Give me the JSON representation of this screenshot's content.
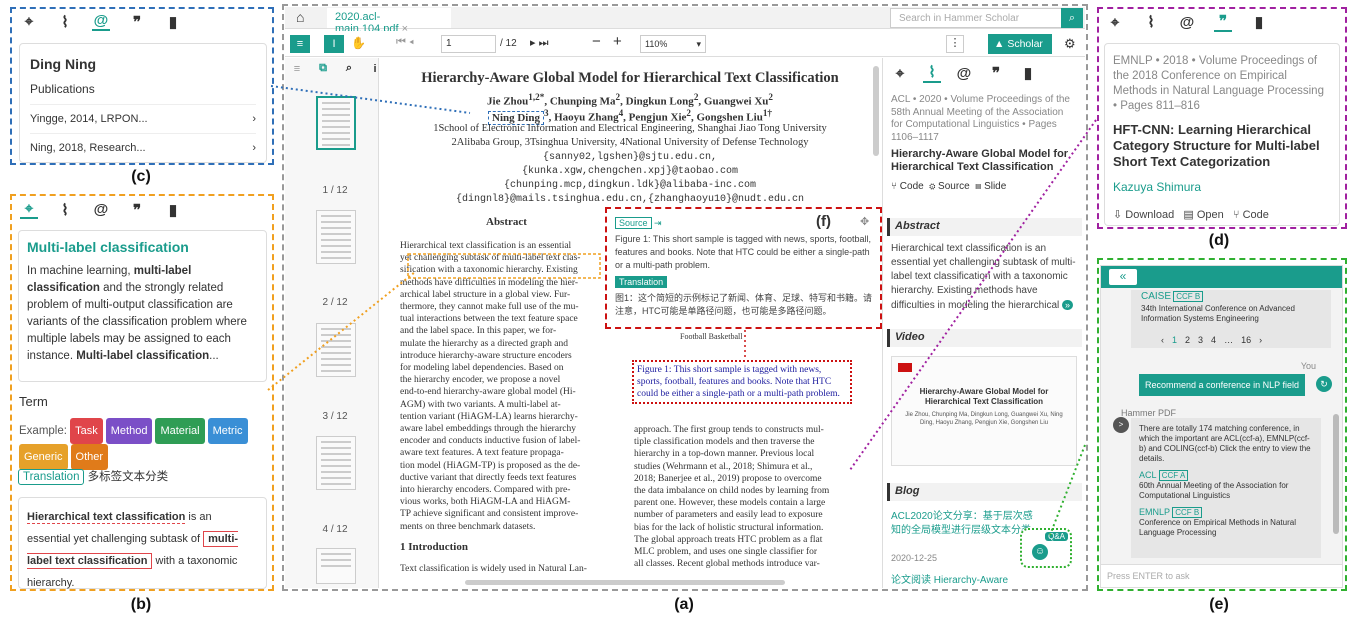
{
  "panel_labels": {
    "a": "(a)",
    "b": "(b)",
    "c": "(c)",
    "d": "(d)",
    "e": "(e)",
    "f": "(f)"
  },
  "panel_c": {
    "name": "Ding Ning",
    "section": "Publications",
    "items": [
      "Yingge, 2014, LRPON...",
      "Ning, 2018, Research..."
    ]
  },
  "panel_b": {
    "title": "Multi-label classification",
    "desc_parts": [
      "In machine learning, ",
      "multi-label classification",
      " and the strongly related problem of multi-output classification are variants of the classification problem where multiple labels may be assigned to each instance. ",
      "Multi-label classification",
      "..."
    ],
    "term_title": "Term",
    "example_label": "Example:",
    "tags": [
      {
        "t": "Task",
        "c": "#e0454a"
      },
      {
        "t": "Method",
        "c": "#7b4fc7"
      },
      {
        "t": "Material",
        "c": "#2f9d55"
      },
      {
        "t": "Metric",
        "c": "#3a8fd6"
      },
      {
        "t": "Generic",
        "c": "#e6a12a"
      },
      {
        "t": "Other",
        "c": "#e07b1a"
      }
    ],
    "translation_label": "Translation",
    "translation_text": "多标签文本分类",
    "snippet": {
      "a": "Hierarchical text classification",
      "b": " is an essential yet challenging subtask of ",
      "c": "multi-label text classification",
      "d": " with a taxonomic hierarchy."
    }
  },
  "viewer": {
    "tab": "2020.acl-main.104.pdf",
    "search_placeholder": "Search in Hammer Scholar",
    "page": "1",
    "page_total": "/ 12",
    "zoom": "110%",
    "scholar": "Scholar",
    "thumbs": [
      "1 / 12",
      "2 / 12",
      "3 / 12",
      "4 / 12"
    ],
    "paper": {
      "title": "Hierarchy-Aware Global Model for Hierarchical Text Classification",
      "authors1": "Jie Zhou",
      "authors1b": "1,2*",
      "authors1c": ", Chunping Ma",
      "authors1d": "2",
      "authors1e": ", Dingkun Long",
      "authors1f": "2",
      "authors1g": ", Guangwei Xu",
      "authors1h": "2",
      "authors2a": "Ning Ding",
      "authors2b": "3",
      "authors2c": ", Haoyu Zhang",
      "authors2d": "4",
      "authors2e": ", Pengjun Xie",
      "authors2f": "2",
      "authors2g": ", Gongshen Liu",
      "authors2h": "1†",
      "aff1": "1School of Electronic Information and Electrical Engineering, Shanghai Jiao Tong University",
      "aff2": "2Alibaba Group, 3Tsinghua University, 4National University of Defense Technology",
      "emails": [
        "{sanny02,lgshen}@sjtu.edu.cn,",
        "{kunka.xgw,chengchen.xpj}@taobao.com",
        "{chunping.mcp,dingkun.ldk}@alibaba-inc.com",
        "{dingnl8}@mails.tsinghua.edu.cn,{zhanghaoyu10}@nudt.edu.cn"
      ],
      "abstract_h": "Abstract",
      "abstract_lines": [
        "Hierarchical text classification is an essential",
        "yet challenging subtask of multi-label text clas-",
        "sification with a taxonomic hierarchy. Existing",
        "methods have difficulties in modeling the hier-",
        "archical label structure in a global view. Fur-",
        "thermore, they cannot make full use of the mu-",
        "tual interactions between the text feature space",
        "and the label space. In this paper, we for-",
        "mulate the hierarchy as a directed graph and",
        "introduce hierarchy-aware structure encoders",
        "for modeling label dependencies. Based on",
        "the hierarchy encoder, we propose a novel",
        "end-to-end hierarchy-aware global model (Hi-",
        "AGM) with two variants. A multi-label at-",
        "tention variant (HiAGM-LA) learns hierarchy-",
        "aware label embeddings through the hierarchy",
        "encoder and conducts inductive fusion of label-",
        "aware text features. A text feature propaga-",
        "tion model (HiAGM-TP) is proposed as the de-",
        "ductive variant that directly feeds text features",
        "into hierarchy encoders. Compared with pre-",
        "vious works, both HiAGM-LA and HiAGM-",
        "TP achieve significant and consistent improve-",
        "ments on three benchmark datasets."
      ],
      "intro_h": "1   Introduction",
      "intro_line": "Text classification is widely used in Natural Lan-",
      "fig_labels": "Football  Basketball",
      "fig_caption": "Figure 1: This short sample is tagged with news, sports, football, features and books. Note that HTC could be either a single-path or a multi-path problem.",
      "right_lines": [
        "approach. The first group tends to constructs mul-",
        "tiple classification models and then traverse the",
        "hierarchy in a top-down manner. Previous local",
        "studies (Wehrmann et al., 2018; Shimura et al.,",
        "2018; Banerjee et al., 2019) propose to overcome",
        "the data imbalance on child nodes by learning from",
        "parent one. However, these models contain a large",
        "number of parameters and easily lead to exposure",
        "bias for the lack of holistic structural information.",
        "The global approach treats HTC problem as a flat",
        "MLC problem, and uses one single classifier for",
        "all classes. Recent global methods introduce var-"
      ]
    },
    "popup": {
      "source": "Source",
      "text": "Figure 1: This short sample is tagged with news, sports, football, features and books. Note that HTC could be either a single-path or a multi-path problem.",
      "translation": "Translation",
      "trans_text": "图1：这个简短的示例标记了新闻、体育、足球、特写和书籍。请注意，HTC可能是单路径问题，也可能是多路径问题。"
    },
    "side": {
      "meta": "ACL • 2020 • Volume Proceedings of the 58th Annual Meeting of the Association for Computational Linguistics • Pages 1106–1117",
      "venue": "ACL",
      "title": "Hierarchy-Aware Global Model for Hierarchical Text Classification",
      "links": [
        "Code",
        "Source",
        "Slide"
      ],
      "abstract_h": "Abstract",
      "abstract": "Hierarchical text classification is an essential yet challenging subtask of multi-label text classification with a taxonomic hierarchy. Existing methods have difficulties in modeling the hierarchical",
      "video_h": "Video",
      "video_title": "Hierarchy-Aware Global Model for Hierarchical Text Classification",
      "video_authors": "Jie Zhou, Chunping Ma, Dingkun Long, Guangwei Xu, Ning Ding, Haoyu Zhang, Pengjun Xie, Gongshen Liu",
      "blog_h": "Blog",
      "blog1": "ACL2020论文分享：基于层次感知的全局模型进行层级文本分类",
      "blog1_date": "2020-12-25",
      "blog2": "论文阅读 Hierarchy-Aware",
      "qa": "Q&A"
    }
  },
  "panel_d": {
    "meta": "EMNLP • 2018 • Volume Proceedings of the 2018 Conference on Empirical Methods in Natural Language Processing • Pages 811–816",
    "venue": "EMNLP",
    "title": "HFT-CNN: Learning Hierarchical Category Structure for Multi-label Short Text Categorization",
    "author": "Kazuya Shimura",
    "actions": [
      "Download",
      "Open",
      "Code"
    ]
  },
  "panel_e": {
    "back": "«",
    "caise": "CAISE",
    "caise_tag": "CCF B",
    "caise_desc": "34th International Conference on Advanced Information Systems Engineering",
    "pages": [
      "‹",
      "1",
      "2",
      "3",
      "4",
      "…",
      "16",
      "›"
    ],
    "you": "You",
    "user_msg": "Recommend a conference in NLP field",
    "bot_name": "Hammer PDF",
    "bot_msg": "There are totally 174 matching conference, in which the important are ACL(ccf-a), EMNLP(ccf-b) and COLING(ccf-b) Click the entry to view the details.",
    "acl": "ACL",
    "acl_tag": "CCF A",
    "acl_desc": "60th Annual Meeting of the Association for Computational Linguistics",
    "emnlp": "EMNLP",
    "emnlp_tag": "CCF B",
    "emnlp_desc": "Conference on Empirical Methods in Natural Language Processing",
    "input_placeholder": "Press ENTER to ask"
  },
  "colors": {
    "teal": "#1a9c8c",
    "blue": "#2f6fb8",
    "orange": "#f0a020",
    "purple": "#a020a0",
    "green": "#30b030",
    "red": "#cc1111"
  }
}
